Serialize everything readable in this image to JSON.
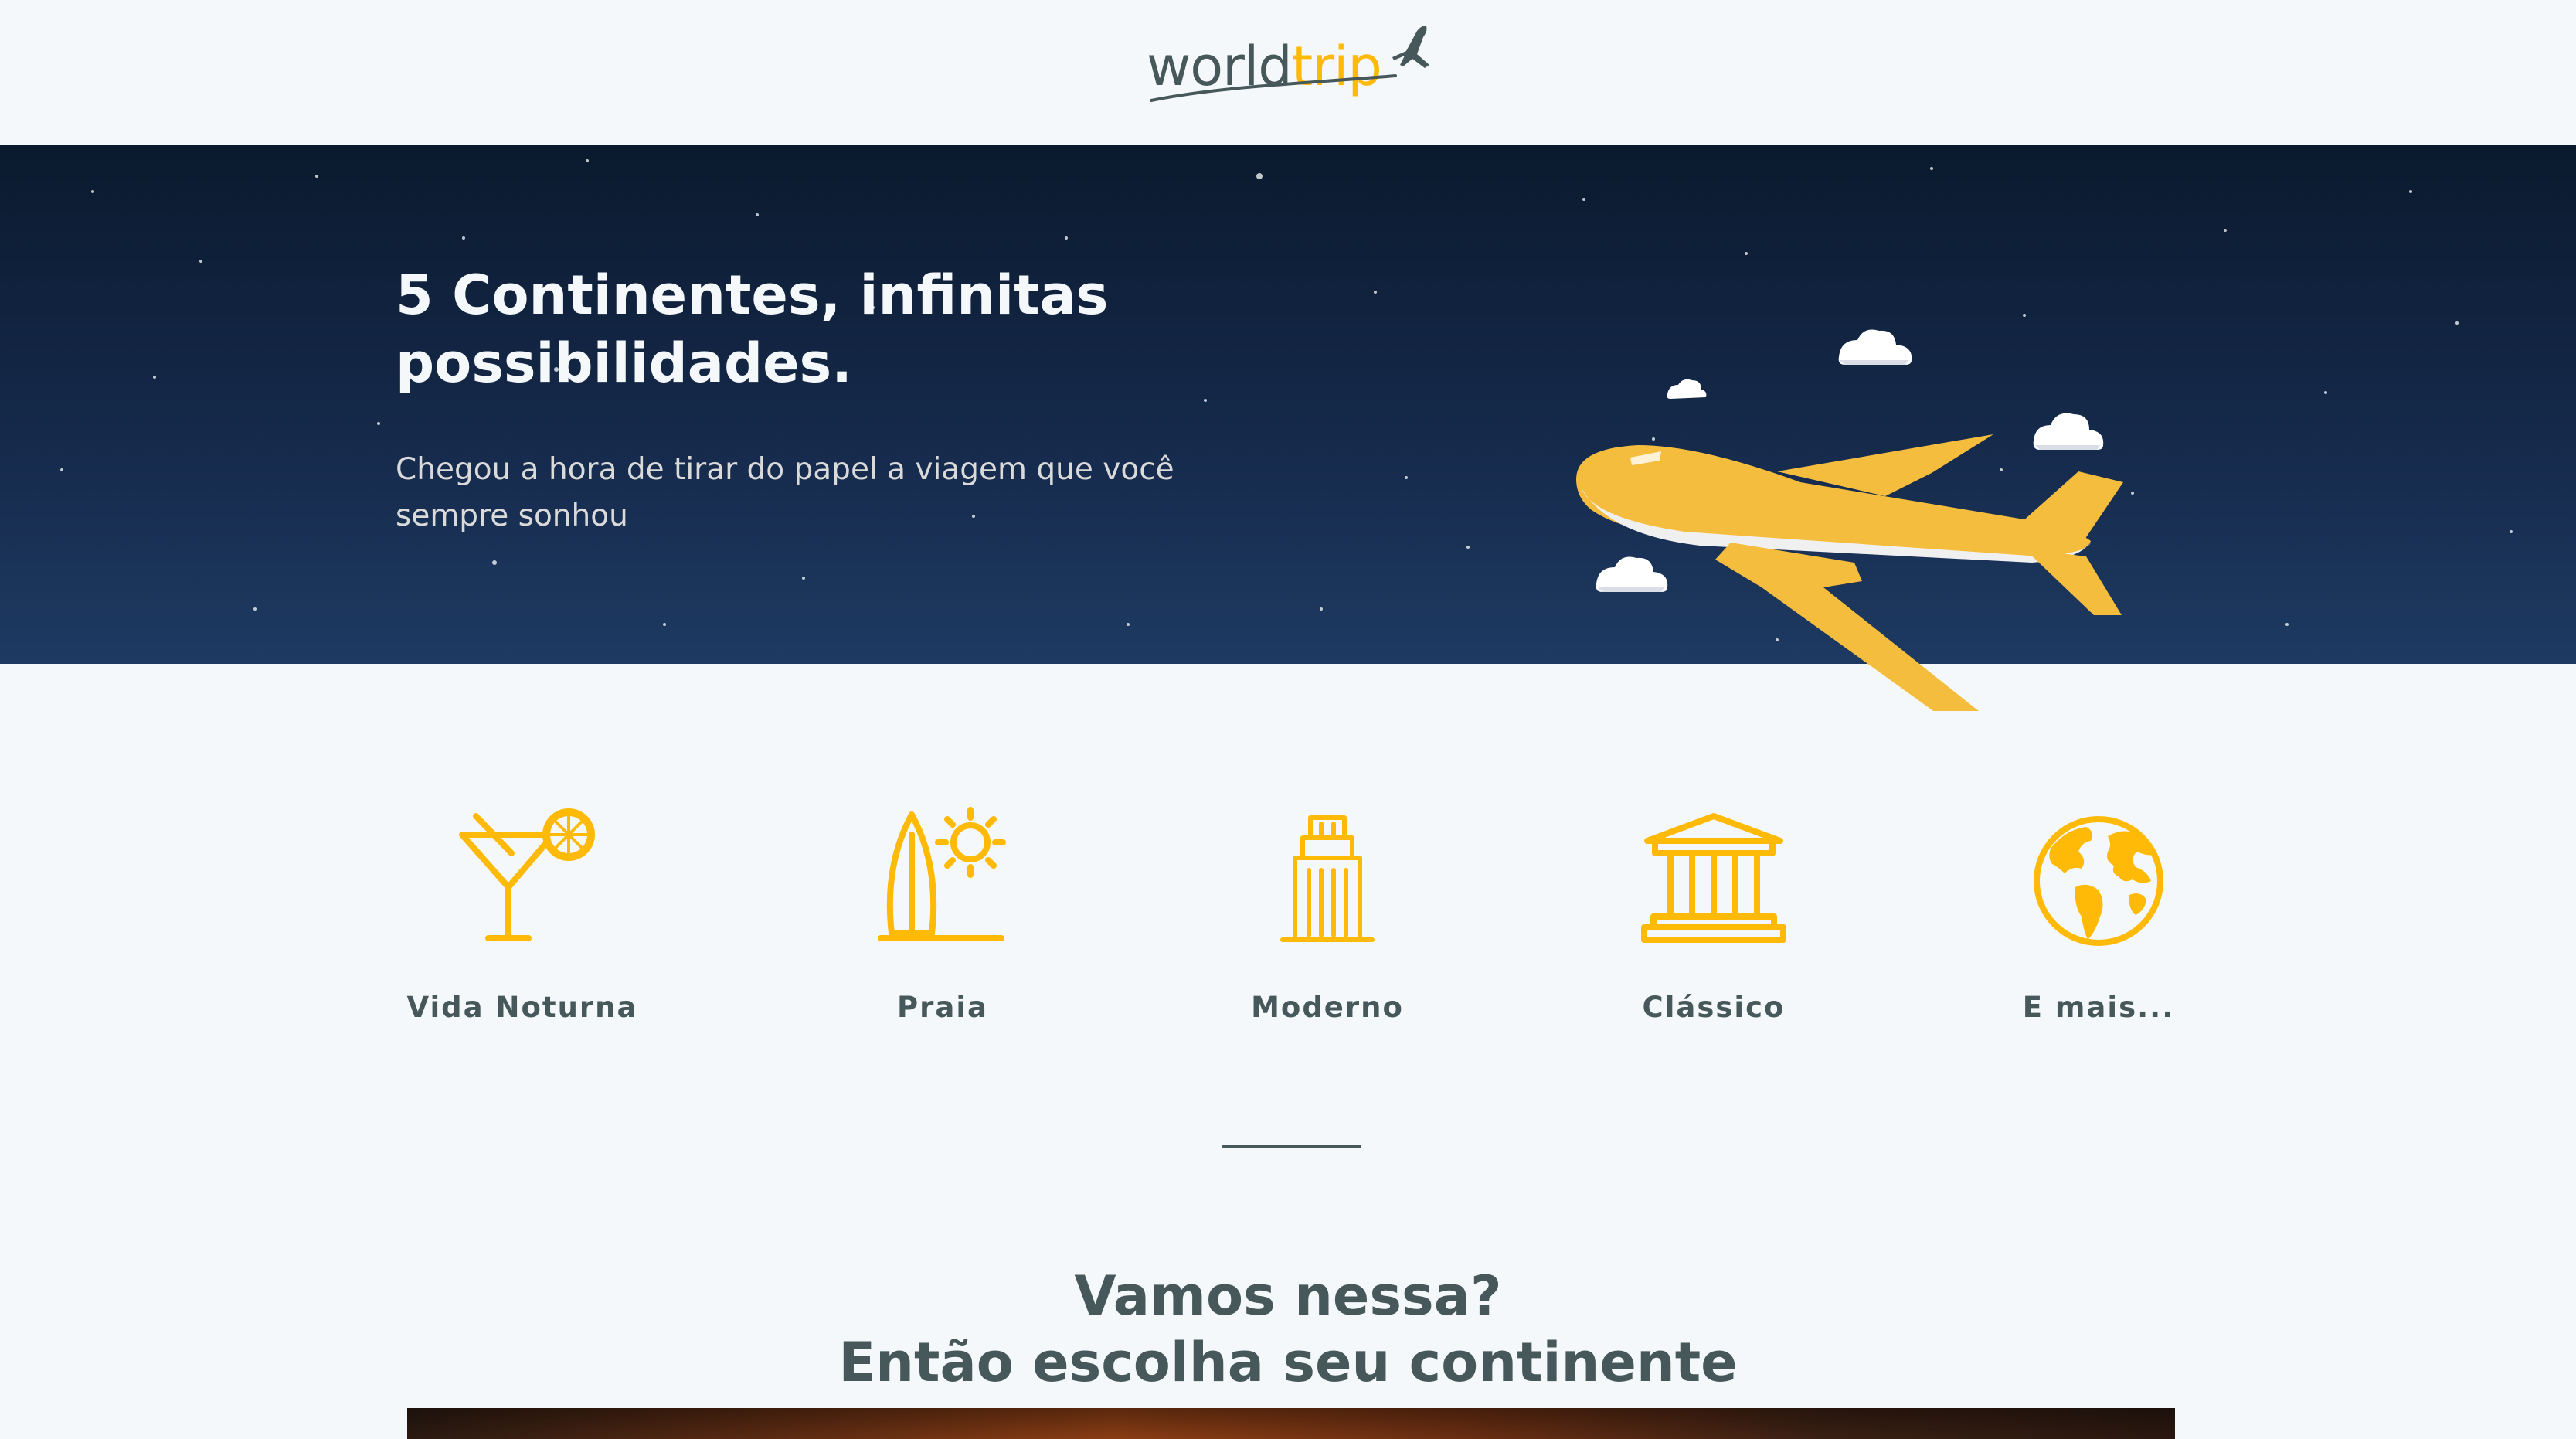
{
  "header": {
    "logo": {
      "word_primary": "world",
      "word_accent": "trip",
      "icon": "airplane-icon"
    }
  },
  "hero": {
    "title": "5 Continentes, infinitas possibilidades.",
    "subtitle": "Chegou a hora de tirar do papel a viagem que você sempre sonhou",
    "illustration": "airplane-with-clouds"
  },
  "travel_types": [
    {
      "label": "Vida Noturna",
      "icon": "cocktail-icon"
    },
    {
      "label": "Praia",
      "icon": "surfboard-sun-icon"
    },
    {
      "label": "Moderno",
      "icon": "skyscraper-icon"
    },
    {
      "label": "Clássico",
      "icon": "museum-icon"
    },
    {
      "label": "E mais...",
      "icon": "globe-icon"
    }
  ],
  "cta": {
    "line1": "Vamos nessa?",
    "line2": "Então escolha seu continente"
  },
  "colors": {
    "accent": "#ffba08",
    "text_dark": "#47585b",
    "background": "#f5f8fa",
    "hero_dark": "#0a1a2e",
    "text_light": "#f5f8fa"
  }
}
